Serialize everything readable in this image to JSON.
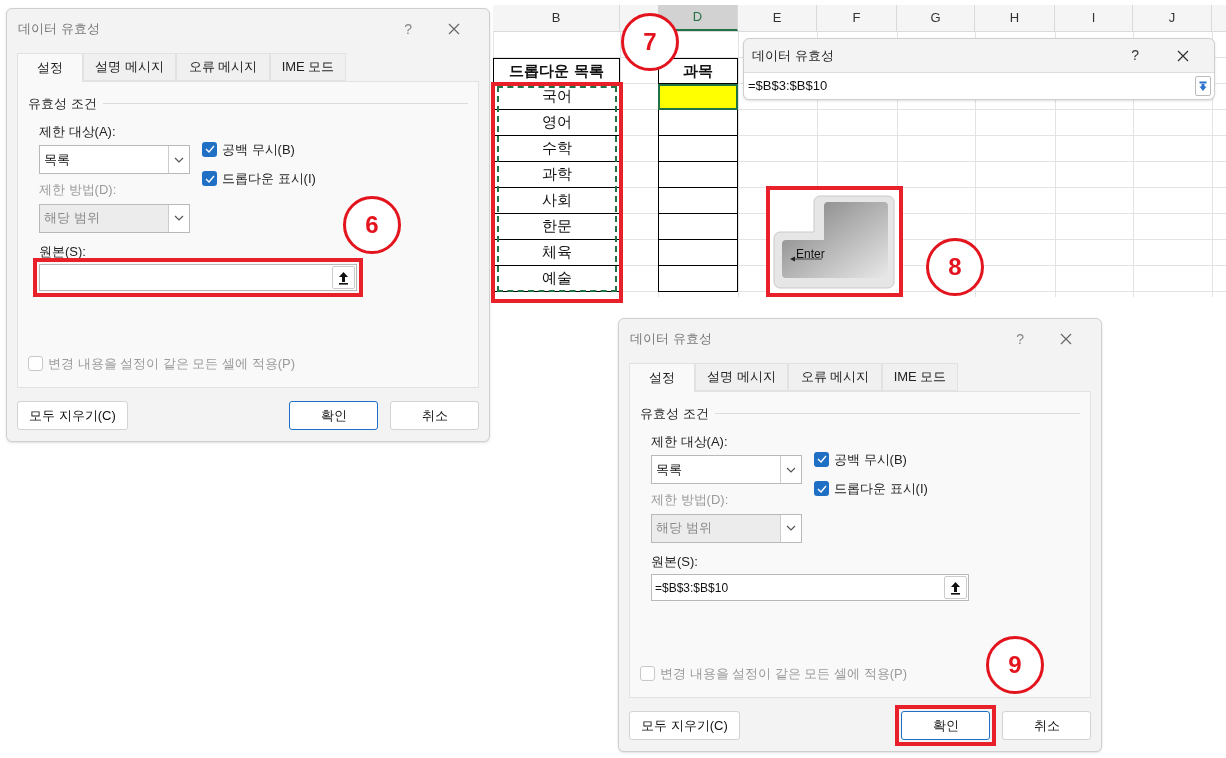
{
  "dialogs": [
    {
      "title": "데이터 유효성",
      "help": "?",
      "tabs": [
        {
          "label": "설정",
          "selected": true
        },
        {
          "label": "설명 메시지",
          "selected": false
        },
        {
          "label": "오류 메시지",
          "selected": false
        },
        {
          "label": "IME 모드",
          "selected": false
        }
      ],
      "group_title": "유효성 조건",
      "allow_label": "제한 대상(A):",
      "allow_value": "목록",
      "options": [
        {
          "label": "공백 무시(B)",
          "checked": true
        },
        {
          "label": "드롭다운 표시(I)",
          "checked": true
        }
      ],
      "data_label": "제한 방법(D):",
      "data_value": "해당 범위",
      "data_disabled": true,
      "source_label": "원본(S):",
      "source_highlighted": true,
      "apply_all": {
        "label": "변경 내용을 설정이 같은 모든 셀에 적용(P)",
        "checked": false,
        "disabled": true
      },
      "buttons": [
        {
          "label": "모두 지우기(C)",
          "kind": "clear",
          "highlighted": false
        },
        {
          "label": "확인",
          "kind": "ok",
          "highlighted": false
        },
        {
          "label": "취소",
          "kind": "cancel",
          "highlighted": false
        }
      ]
    },
    {
      "title": "데이터 유효성",
      "help": "?",
      "tabs": [
        {
          "label": "설정",
          "selected": true
        },
        {
          "label": "설명 메시지",
          "selected": false
        },
        {
          "label": "오류 메시지",
          "selected": false
        },
        {
          "label": "IME 모드",
          "selected": false
        }
      ],
      "group_title": "유효성 조건",
      "allow_label": "제한 대상(A):",
      "allow_value": "목록",
      "options": [
        {
          "label": "공백 무시(B)",
          "checked": true
        },
        {
          "label": "드롭다운 표시(I)",
          "checked": true
        }
      ],
      "data_label": "제한 방법(D):",
      "data_value": "해당 범위",
      "data_disabled": true,
      "source_label": "원본(S):",
      "source_value": "=$B$3:$B$10",
      "source_highlighted": false,
      "apply_all": {
        "label": "변경 내용을 설정이 같은 모든 셀에 적용(P)",
        "checked": false,
        "disabled": true
      },
      "buttons": [
        {
          "label": "모두 지우기(C)",
          "kind": "clear",
          "highlighted": false
        },
        {
          "label": "확인",
          "kind": "ok",
          "highlighted": true
        },
        {
          "label": "취소",
          "kind": "cancel",
          "highlighted": false
        }
      ]
    }
  ],
  "sheet": {
    "columns": [
      {
        "label": "B",
        "selected": false
      },
      {
        "label": "D",
        "selected": true
      },
      {
        "label": "E",
        "selected": false
      },
      {
        "label": "F",
        "selected": false
      },
      {
        "label": "G",
        "selected": false
      },
      {
        "label": "H",
        "selected": false
      },
      {
        "label": "I",
        "selected": false
      },
      {
        "label": "J",
        "selected": false
      }
    ],
    "list_header": "드롭다운 목록",
    "list_items": [
      "국어",
      "영어",
      "수학",
      "과학",
      "사회",
      "한문",
      "체육",
      "예술"
    ],
    "list_highlighted": true,
    "subject_header": "과목",
    "subject_cells": [
      {
        "selected": true
      },
      {
        "selected": false
      },
      {
        "selected": false
      },
      {
        "selected": false
      },
      {
        "selected": false
      },
      {
        "selected": false
      },
      {
        "selected": false
      },
      {
        "selected": false
      }
    ]
  },
  "range_picker": {
    "title": "데이터 유효성",
    "help": "?",
    "value": "=$B$3:$B$10"
  },
  "enter_key": {
    "label": "Enter",
    "highlighted": true
  },
  "callouts": [
    {
      "number": "6"
    },
    {
      "number": "7"
    },
    {
      "number": "8"
    },
    {
      "number": "9"
    }
  ]
}
